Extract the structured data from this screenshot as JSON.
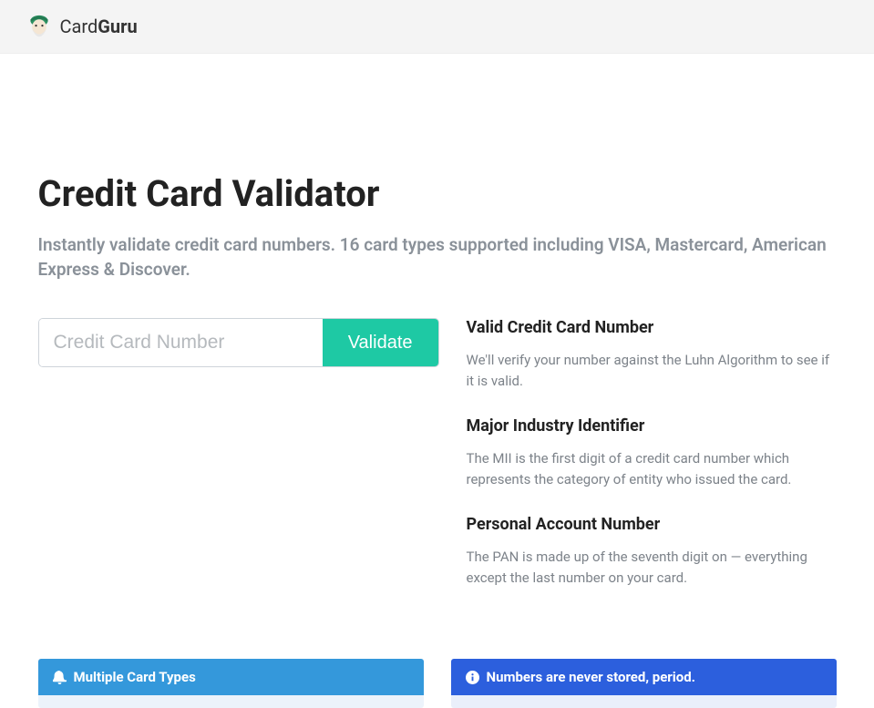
{
  "header": {
    "brand_prefix": "Card",
    "brand_bold": "Guru"
  },
  "page": {
    "title": "Credit Card Validator",
    "subtitle": "Instantly validate credit card numbers. 16 card types supported including VISA, Mastercard, American Express & Discover."
  },
  "form": {
    "input_placeholder": "Credit Card Number",
    "button_label": "Validate"
  },
  "info": [
    {
      "title": "Valid Credit Card Number",
      "body": "We'll verify your number against the Luhn Algorithm to see if it is valid."
    },
    {
      "title": "Major Industry Identifier",
      "body": "The MII is the first digit of a credit card number which represents the category of entity who issued the card."
    },
    {
      "title": "Personal Account Number",
      "body": "The PAN is made up of the seventh digit on — everything except the last number on your card."
    }
  ],
  "cards": [
    {
      "header": "Multiple Card Types"
    },
    {
      "header": "Numbers are never stored, period."
    }
  ]
}
